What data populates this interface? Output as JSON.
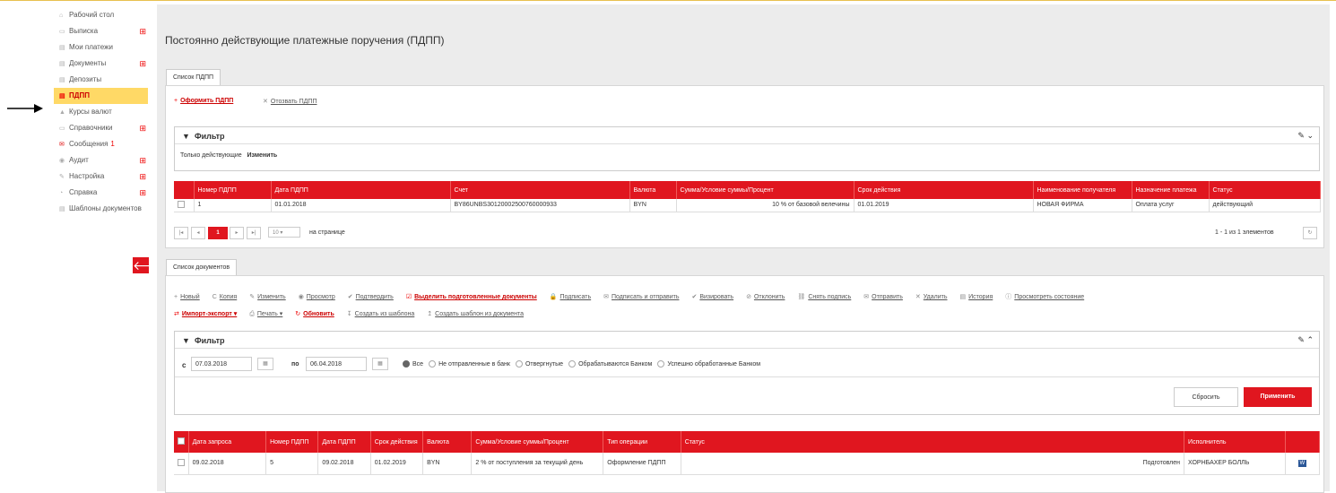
{
  "sidebar": {
    "items": [
      {
        "icon": "⌂",
        "label": "Рабочий стол",
        "plus": false
      },
      {
        "icon": "▭",
        "label": "Выписка",
        "plus": true
      },
      {
        "icon": "▤",
        "label": "Мои платежи",
        "plus": false
      },
      {
        "icon": "▤",
        "label": "Документы",
        "plus": true
      },
      {
        "icon": "▤",
        "label": "Депозиты",
        "plus": false
      },
      {
        "icon": "▤",
        "label": "ПДПП",
        "plus": false,
        "active": true
      },
      {
        "icon": "▲",
        "label": "Курсы валют",
        "plus": false
      },
      {
        "icon": "▭",
        "label": "Справочники",
        "plus": true
      },
      {
        "icon": "✉",
        "label": "Сообщения",
        "plus": false,
        "count": "1"
      },
      {
        "icon": "◉",
        "label": "Аудит",
        "plus": true
      },
      {
        "icon": "✎",
        "label": "Настройка",
        "plus": true
      },
      {
        "icon": "◔",
        "label": "Справка",
        "plus": true
      },
      {
        "icon": "▤",
        "label": "Шаблоны документов",
        "plus": false
      }
    ]
  },
  "page": {
    "title": "Постоянно действующие платежные поручения (ПДПП)"
  },
  "pdpp_tab": {
    "label": "Список ПДПП"
  },
  "pdpp_actions": {
    "create": "Оформить ПДПП",
    "revoke": "Отозвать ПДПП"
  },
  "filter1": {
    "title": "Фильтр",
    "only_active": "Только действующие",
    "change": "Изменить"
  },
  "pdpp_table": {
    "headers": [
      "Номер ПДПП",
      "Дата ПДПП",
      "Счет",
      "Валюта",
      "Сумма/Условие суммы/Процент",
      "Срок действия",
      "Наименование получателя",
      "Назначение платежа",
      "Статус"
    ],
    "rows": [
      [
        "1",
        "01.01.2018",
        "BY86UNBS30120002500760000933",
        "BYN",
        "10 % от базовой велечины",
        "01.01.2019",
        "НОВАЯ ФИРМА",
        "Оплата услуг",
        "действующий"
      ]
    ]
  },
  "pager1": {
    "page": "1",
    "per_page": "10",
    "per_page_label": "на странице",
    "summary": "1 - 1 из 1 элементов"
  },
  "docs_tab": {
    "label": "Список документов"
  },
  "doc_actions": {
    "row1": [
      "Новый",
      "Копия",
      "Изменить",
      "Просмотр",
      "Подтвердить",
      "Выделить подготовленные документы",
      "Подписать",
      "Подписать и отправить",
      "Визировать",
      "Отклонить",
      "Снять подпись",
      "Отправить",
      "Удалить",
      "История",
      "Просмотреть состояние"
    ],
    "row2": [
      "Импорт-экспорт ▾",
      "Печать ▾",
      "Обновить",
      "Создать из шаблона",
      "Создать шаблон из документа"
    ]
  },
  "filter2": {
    "title": "Фильтр",
    "from_label": "с",
    "from": "07.03.2018",
    "to_label": "по",
    "to": "06.04.2018",
    "options": [
      "Все",
      "Не отправленные в банк",
      "Отвергнутые",
      "Обрабатываются Банком",
      "Успешно обработанные Банком"
    ],
    "reset": "Сбросить",
    "apply": "Применить"
  },
  "docs_table": {
    "headers": [
      "Дата запроса",
      "Номер ПДПП",
      "Дата ПДПП",
      "Срок действия",
      "Валюта",
      "Сумма/Условие суммы/Процент",
      "Тип операции",
      "Статус",
      "Исполнитель"
    ],
    "rows": [
      [
        "09.02.2018",
        "5",
        "09.02.2018",
        "01.02.2019",
        "BYN",
        "2 % от поступления за текущий день",
        "Оформление ПДПП",
        "Подготовлен",
        "ХОРНБАХЕР БОЛЛЬ"
      ]
    ]
  },
  "colors": {
    "accent": "#e0161f",
    "active_bg": "#ffd966"
  }
}
